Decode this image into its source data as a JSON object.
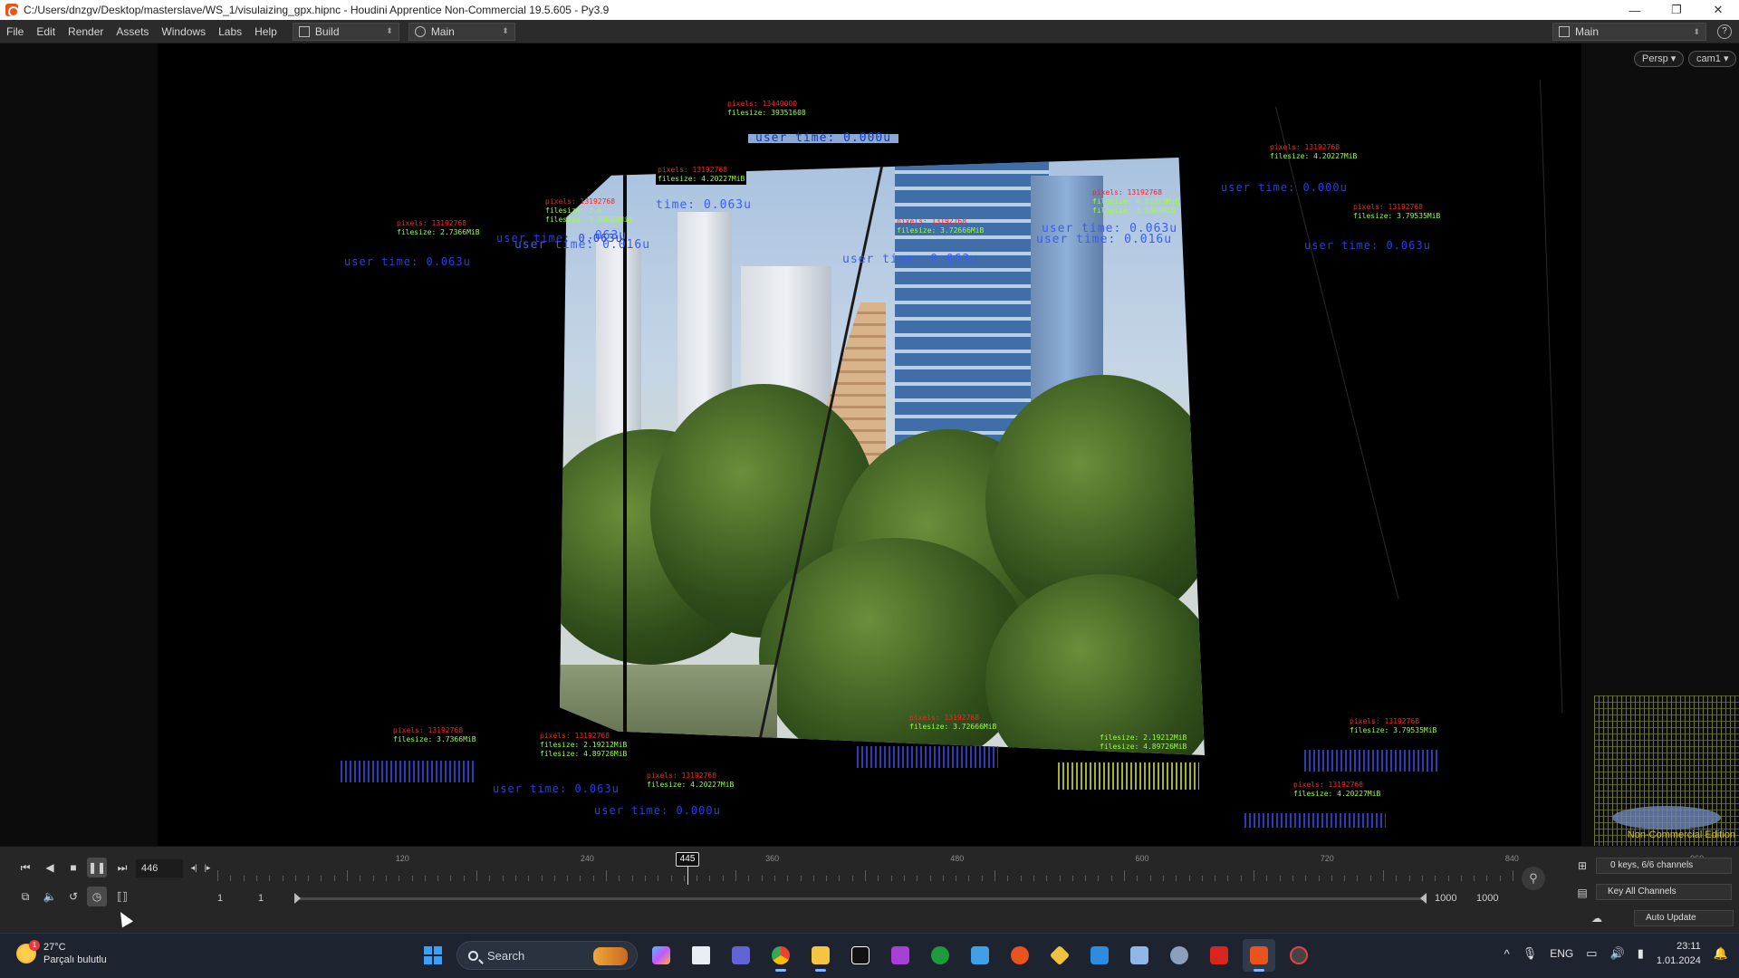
{
  "titlebar": {
    "title": "C:/Users/dnzgv/Desktop/masterslave/WS_1/visulaizing_gpx.hipnc - Houdini Apprentice Non-Commercial 19.5.605 - Py3.9",
    "minimize": "—",
    "restore": "❐",
    "close": "✕"
  },
  "menubar": {
    "items": [
      "File",
      "Edit",
      "Render",
      "Assets",
      "Windows",
      "Labs",
      "Help"
    ],
    "desk_build": "Build",
    "desk_main": "Main",
    "desk_right": "Main",
    "help": "?"
  },
  "viewport": {
    "persp": "Persp ▾",
    "cam": "cam1 ▾",
    "non_commercial": "Non-Commercial Edition",
    "overlays": {
      "top_red": "pixels: 13440000",
      "top_green": "filesize: 39351608",
      "top_user": "user time: 0.000u",
      "c1_red": "pixels: 13192768",
      "c1_green": "filesize: 4.20227MiB",
      "c1_user": "time: 0.063u",
      "c2_red": "pixels: 13192768",
      "c2_green_a": "filesize: 3.6",
      "c2_green_b": "filesize: 3.80606MiB",
      "c2_user_a": ".063u",
      "c2_user_b": "user time: 0.016u",
      "left_red": "pixels: 13192768",
      "left_green": "filesize: 2.7366MiB",
      "left_user_a": "user time: 0.063u",
      "left_user_b": "user time: 0.063u",
      "mid_red": "pixels: 13192768",
      "mid_green": "filesize: 3.72666MiB",
      "mid_user": "user time: 0.063u",
      "r1_red": "pixels: 13192768",
      "r1_green_a": "filesize: 4.82323MiB",
      "r1_green_b": "filesize: 3.8303MiB",
      "r1_user_a": "user time: 0.063u",
      "r1_user_b": "user time: 0.016u",
      "far_red": "pixels: 13192768",
      "far_green": "filesize: 4.20227MiB",
      "far_user": "user time: 0.000u",
      "far2_red": "pixels: 13192768",
      "far2_green": "filesize: 3.79535MiB",
      "far2_user": "user time: 0.063u",
      "b1_red": "pixels: 13192768",
      "b1_green": "filesize: 3.7366MiB",
      "b2_red": "pixels: 13192768",
      "b2_green_a": "filesize: 2.19212MiB",
      "b2_green_b": "filesize: 4.89726MiB",
      "b2_user": "user time: 0.063u",
      "b3_red": "pixels: 13192768",
      "b3_green": "filesize: 4.20227MiB",
      "b3_user": "user time: 0.000u",
      "b4_red": "pixels: 13192768",
      "b4_green": "filesize: 3.72666MiB",
      "b5_green_a": "filesize: 2.19212MiB",
      "b5_green_b": "filesize: 4.89726MiB",
      "b6_red": "pixels: 13192768",
      "b6_green": "filesize: 3.79535MiB",
      "b7_red": "pixels: 13192768",
      "b7_green": "filesize: 4.20227MiB"
    }
  },
  "timeline": {
    "current_frame": "446",
    "playhead": "445",
    "playhead_fraction": 0.363,
    "ticks": [
      "120",
      "240",
      "360",
      "480",
      "600",
      "720",
      "840",
      "960"
    ],
    "range_start": "1",
    "range_start2": "1",
    "range_end": "1000",
    "range_end2": "1000",
    "keys": "0 keys, 6/6 channels",
    "key_all": "Key All Channels",
    "auto_update": "Auto Update"
  },
  "taskbar": {
    "weather_temp": "27°C",
    "weather_desc": "Parçalı bulutlu",
    "weather_badge": "1",
    "search": "Search",
    "lang": "ENG",
    "time": "23:11",
    "date": "1.01.2024",
    "tray_up": "^"
  },
  "colors": {
    "overlay_red": "#ff2222",
    "overlay_green": "#9bff3d",
    "overlay_blue": "#2a3fd9",
    "houdini_orange": "#e8541c",
    "nce_yellow": "#d5c41f"
  }
}
